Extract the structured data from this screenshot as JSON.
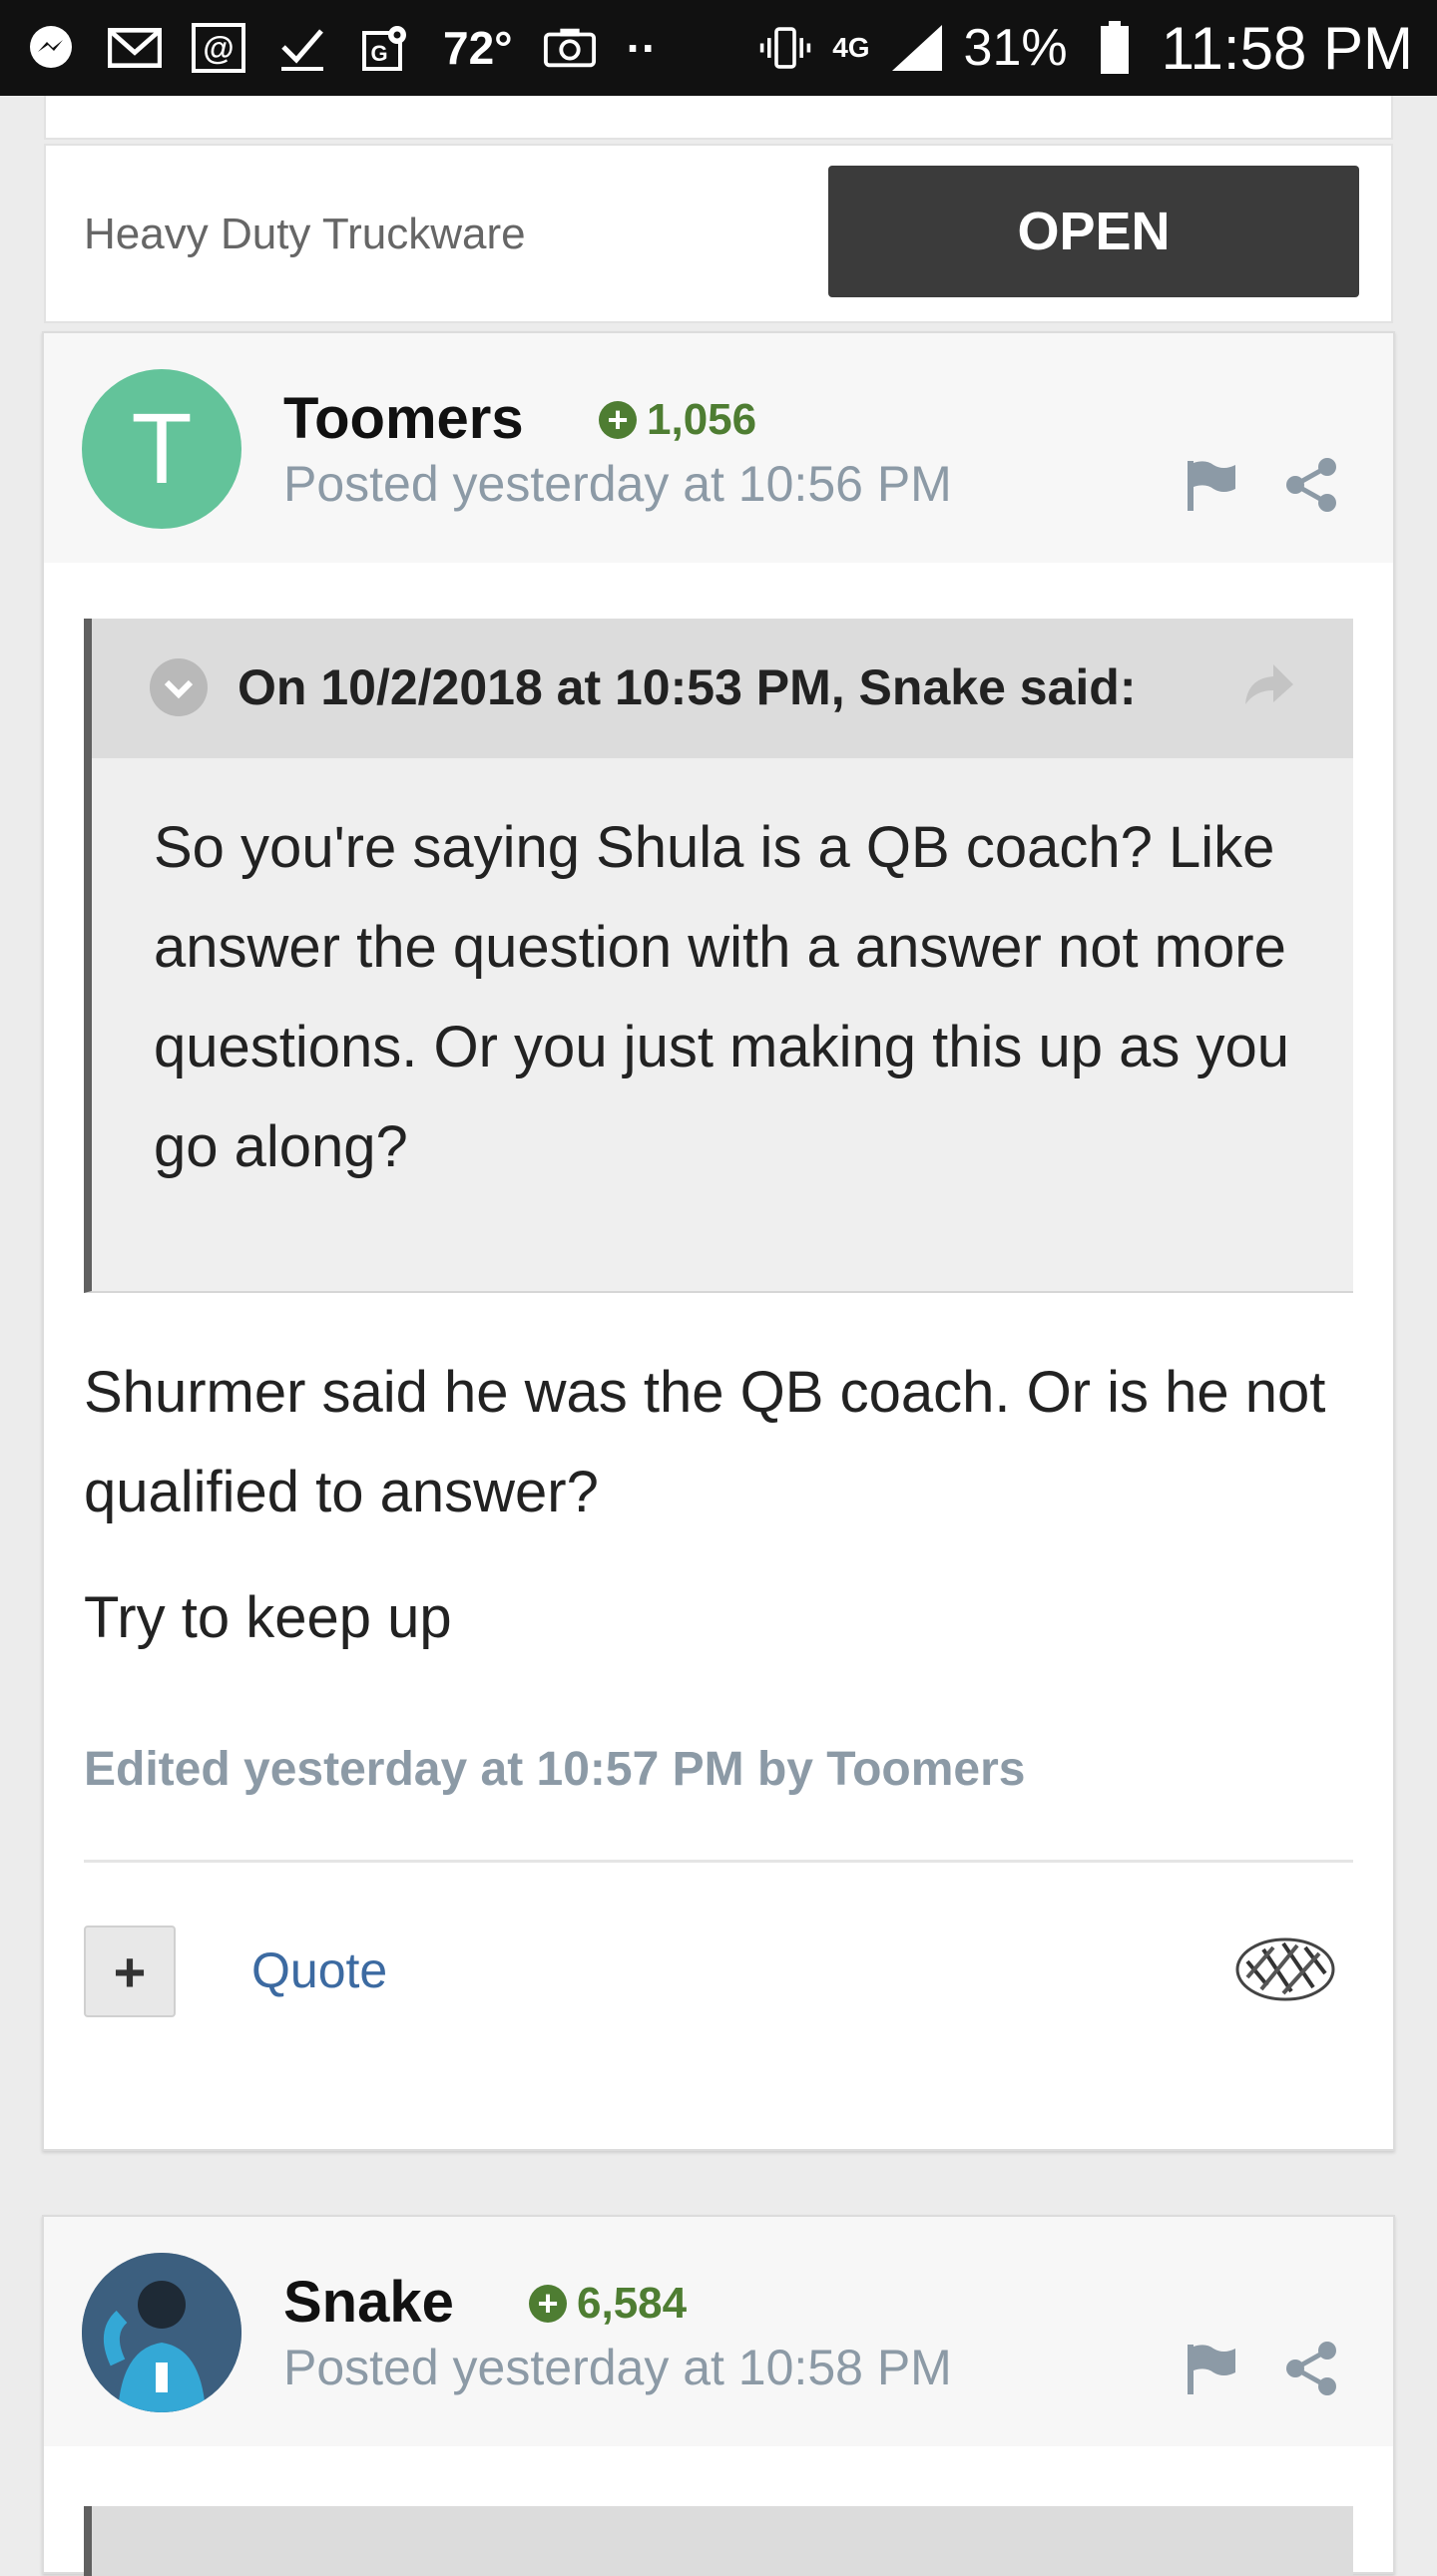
{
  "status_bar": {
    "temperature": "72°",
    "battery": "31%",
    "time": "11:58 PM",
    "network": "4G",
    "dots": "··",
    "icons": [
      "messenger-icon",
      "gmail-icon",
      "email-at-icon",
      "checkmark-icon",
      "maps-icon",
      "camera-icon",
      "vibrate-icon",
      "network-icon",
      "signal-icon",
      "battery-icon"
    ]
  },
  "ad": {
    "title": "Heavy Duty Truckware",
    "button_label": "OPEN"
  },
  "post1": {
    "avatar_letter": "T",
    "author": "Toomers",
    "reputation": "1,056",
    "posted": "Posted yesterday at 10:56 PM",
    "quote": {
      "attribution": "On 10/2/2018 at 10:53 PM, Snake said:",
      "body": "So you're saying Shula is a QB coach? Like answer the question with a answer not more questions. Or you just making this up as you go along?"
    },
    "paragraphs": [
      "Shurmer said he was the QB coach. Or is he not qualified to answer?",
      "Try to keep up"
    ],
    "edited": "Edited yesterday at 10:57 PM by Toomers",
    "plus_label": "+",
    "quote_label": "Quote"
  },
  "post2": {
    "author": "Snake",
    "reputation": "6,584",
    "posted": "Posted yesterday at 10:58 PM"
  },
  "colors": {
    "status_bar": "#111111",
    "avatar_t": "#63c39a",
    "reputation_green": "#4e7d32",
    "link_blue": "#3c6aa1",
    "muted_gray": "#8c9aa6",
    "open_button": "#3b3b3b"
  }
}
